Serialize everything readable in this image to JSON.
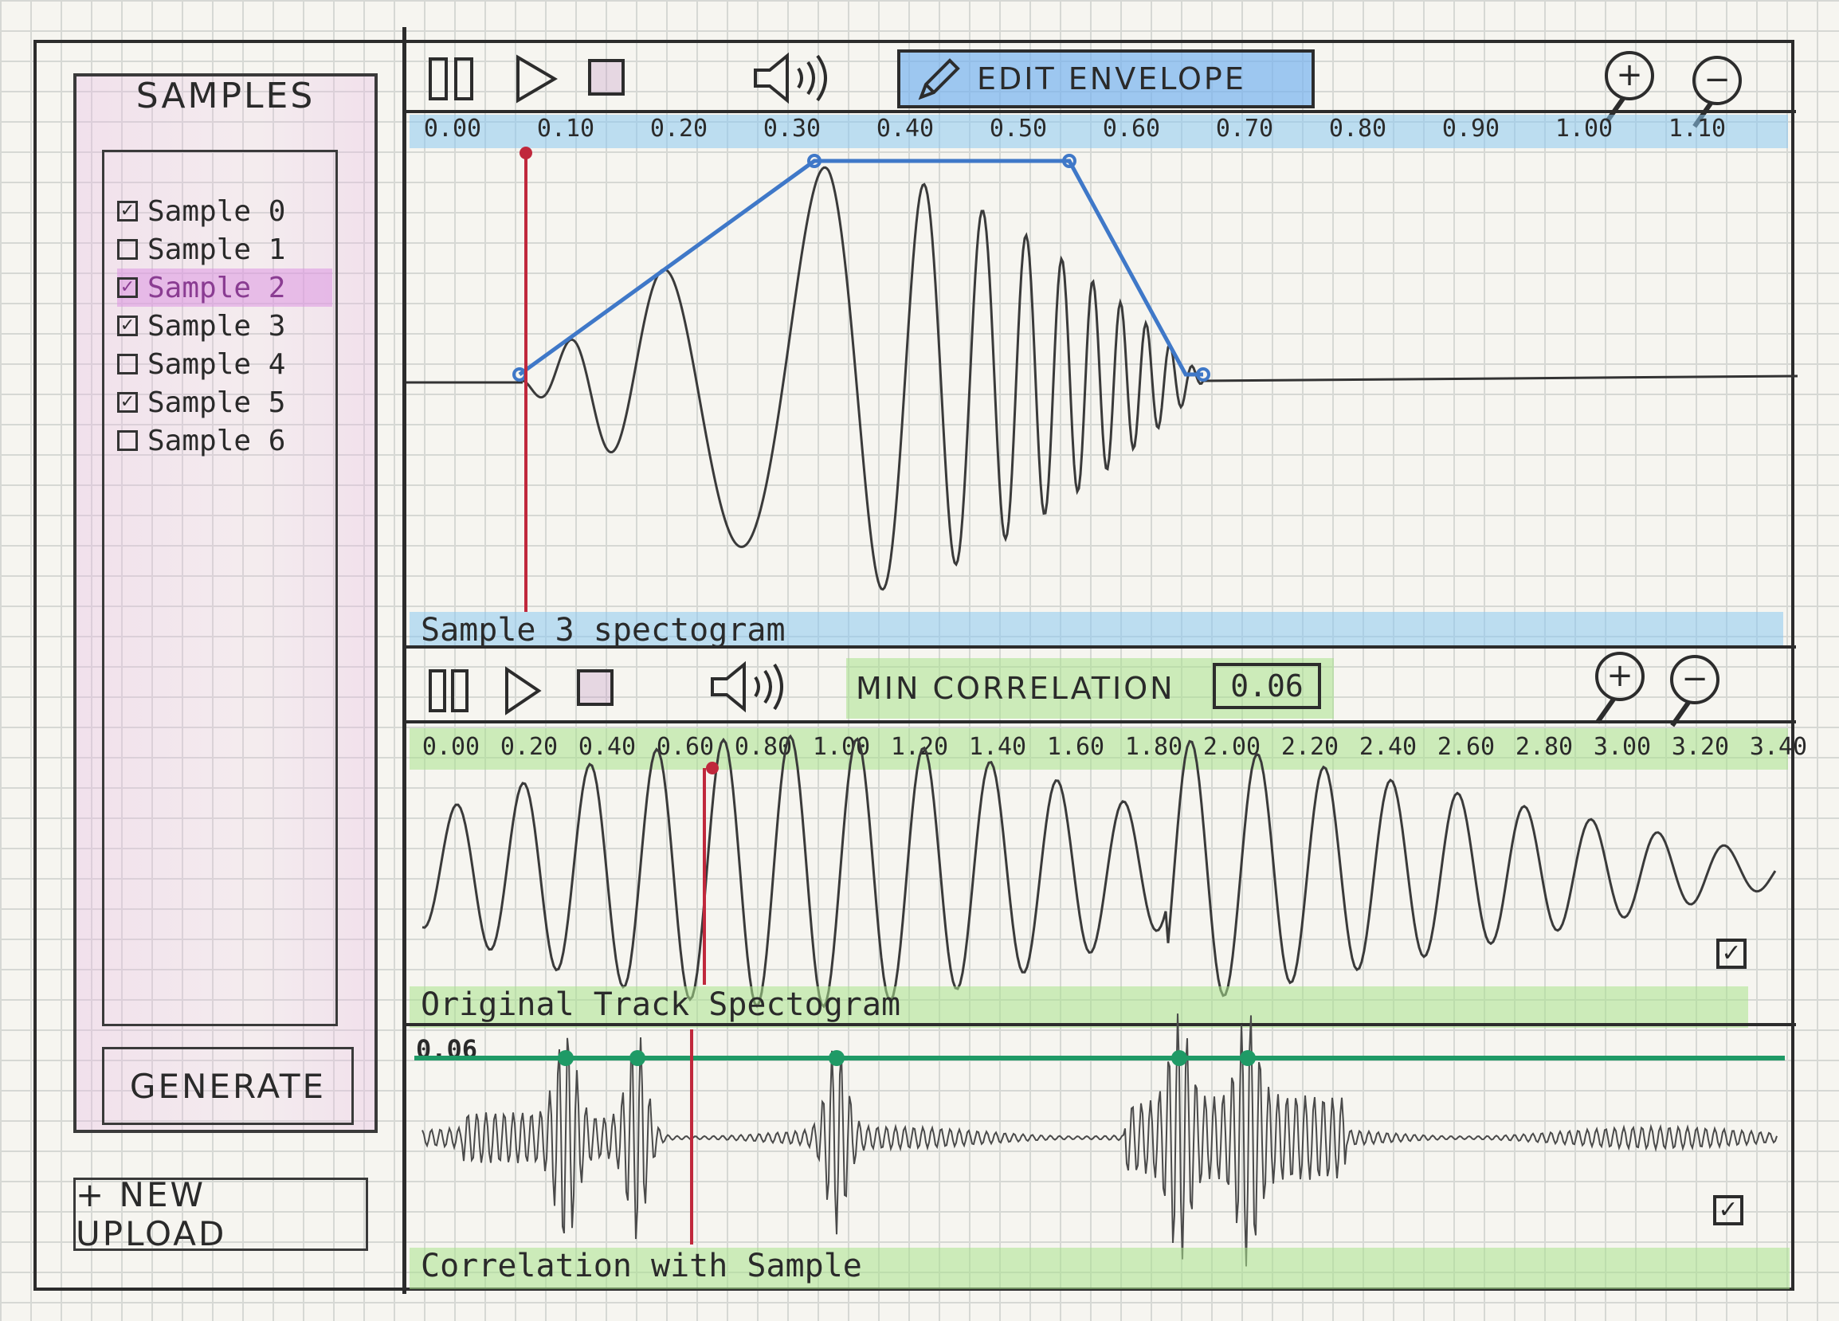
{
  "sidebar": {
    "title": "SAMPLES",
    "items": [
      {
        "label": "Sample 0",
        "checked": true,
        "selected": false
      },
      {
        "label": "Sample 1",
        "checked": false,
        "selected": false
      },
      {
        "label": "Sample 2",
        "checked": true,
        "selected": true
      },
      {
        "label": "Sample 3",
        "checked": true,
        "selected": false
      },
      {
        "label": "Sample 4",
        "checked": false,
        "selected": false
      },
      {
        "label": "Sample 5",
        "checked": true,
        "selected": false
      },
      {
        "label": "Sample 6",
        "checked": false,
        "selected": false
      }
    ],
    "generate_label": "GENERATE",
    "upload_label": "+ NEW UPLOAD"
  },
  "top_panel": {
    "edit_envelope_label": "EDIT ENVELOPE",
    "ticks": [
      "0.00",
      "0.10",
      "0.20",
      "0.30",
      "0.40",
      "0.50",
      "0.60",
      "0.70",
      "0.80",
      "0.90",
      "1.00",
      "1.10"
    ],
    "label": "Sample 3  spectogram"
  },
  "bottom_panel": {
    "min_correlation_label": "MIN CORRELATION",
    "min_correlation_value": "0.06",
    "ticks": [
      "0.00",
      "0.20",
      "0.40",
      "0.60",
      "0.80",
      "1.00",
      "1.20",
      "1.40",
      "1.60",
      "1.80",
      "2.00",
      "2.20",
      "2.40",
      "2.60",
      "2.80",
      "3.00",
      "3.20",
      "3.40"
    ],
    "track_label": "Original Track  Spectogram",
    "threshold_label": "0.06",
    "correlation_label": "Correlation  with  Sample"
  },
  "icons": {
    "pause": "pause-icon",
    "play": "play-icon",
    "stop": "stop-icon",
    "volume": "volume-icon",
    "pencil": "pencil-icon",
    "zoom_in": "zoom-in-icon",
    "zoom_out": "zoom-out-icon",
    "check": "✓"
  },
  "colors": {
    "envelope": "#3f78c8",
    "playhead": "#c0283c",
    "threshold": "#1f9a66",
    "selection": "#d89ae0"
  }
}
